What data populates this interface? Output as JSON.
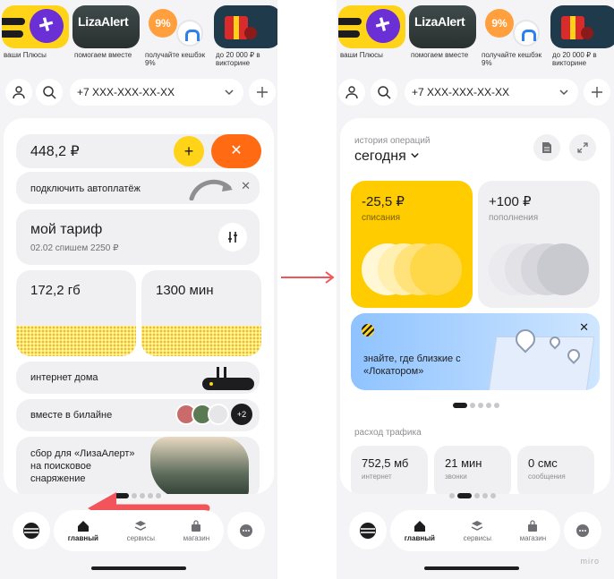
{
  "left": {
    "stories": [
      {
        "caption": "ваши Плюсы"
      },
      {
        "caption": "помогаем вместе",
        "logo": "LizaAlert"
      },
      {
        "caption": "получайте кешбэк 9%",
        "badge": "9%"
      },
      {
        "caption": "до 20 000 ₽ в викторине"
      }
    ],
    "phone_number": "+7 XXX-XXX-XX-XX",
    "balance": "448,2 ₽",
    "plus_label": "+",
    "autopay_text": "подключить автоплатёж",
    "close_mark": "✕",
    "tariff": {
      "title": "мой тариф",
      "subtitle": "02.02 спишем 2250 ₽"
    },
    "data_left": "172,2 гб",
    "minutes_left": "1300 мин",
    "home_internet": "интернет дома",
    "together": "вместе в билайне",
    "together_count": "+2",
    "fund_text": "сбор для «ЛизаАлерт» на поисковое снаряжение",
    "pager": {
      "count": 5,
      "active": 0
    }
  },
  "right": {
    "stories": [
      {
        "caption": "ваши Плюсы"
      },
      {
        "caption": "помогаем вместе",
        "logo": "LizaAlert"
      },
      {
        "caption": "получайте кешбэк 9%",
        "badge": "9%"
      },
      {
        "caption": "до 20 000 ₽ в викторине"
      }
    ],
    "phone_number": "+7 XXX-XXX-XX-XX",
    "history_label": "история операций",
    "history_day": "сегодня",
    "outgoing": {
      "amount": "-25,5 ₽",
      "label": "списания"
    },
    "incoming": {
      "amount": "+100 ₽",
      "label": "пополнения"
    },
    "banner_text": "знайте, где близкие с «Локатором»",
    "banner_pager": {
      "count": 5,
      "active": 0
    },
    "traffic_label": "расход трафика",
    "traffic": [
      {
        "value": "752,5 мб",
        "label": "интернет"
      },
      {
        "value": "21 мин",
        "label": "звонки"
      },
      {
        "value": "0 смс",
        "label": "сообщения"
      }
    ],
    "pager": {
      "count": 5,
      "active": 1
    }
  },
  "nav": {
    "home": "главный",
    "services": "сервисы",
    "shop": "магазин"
  },
  "watermark": "miro",
  "colors": {
    "yellow": "#ffcc00",
    "orange": "#ff6a13",
    "annotation_red": "#f2545b",
    "background": "#f4f4f6"
  },
  "icons": [
    "user-icon",
    "search-icon",
    "chevron-down-icon",
    "plus-icon",
    "sliders-icon",
    "document-icon",
    "expand-icon",
    "home-icon",
    "layers-icon",
    "bag-icon",
    "chat-icon",
    "beeline-logo-icon"
  ]
}
